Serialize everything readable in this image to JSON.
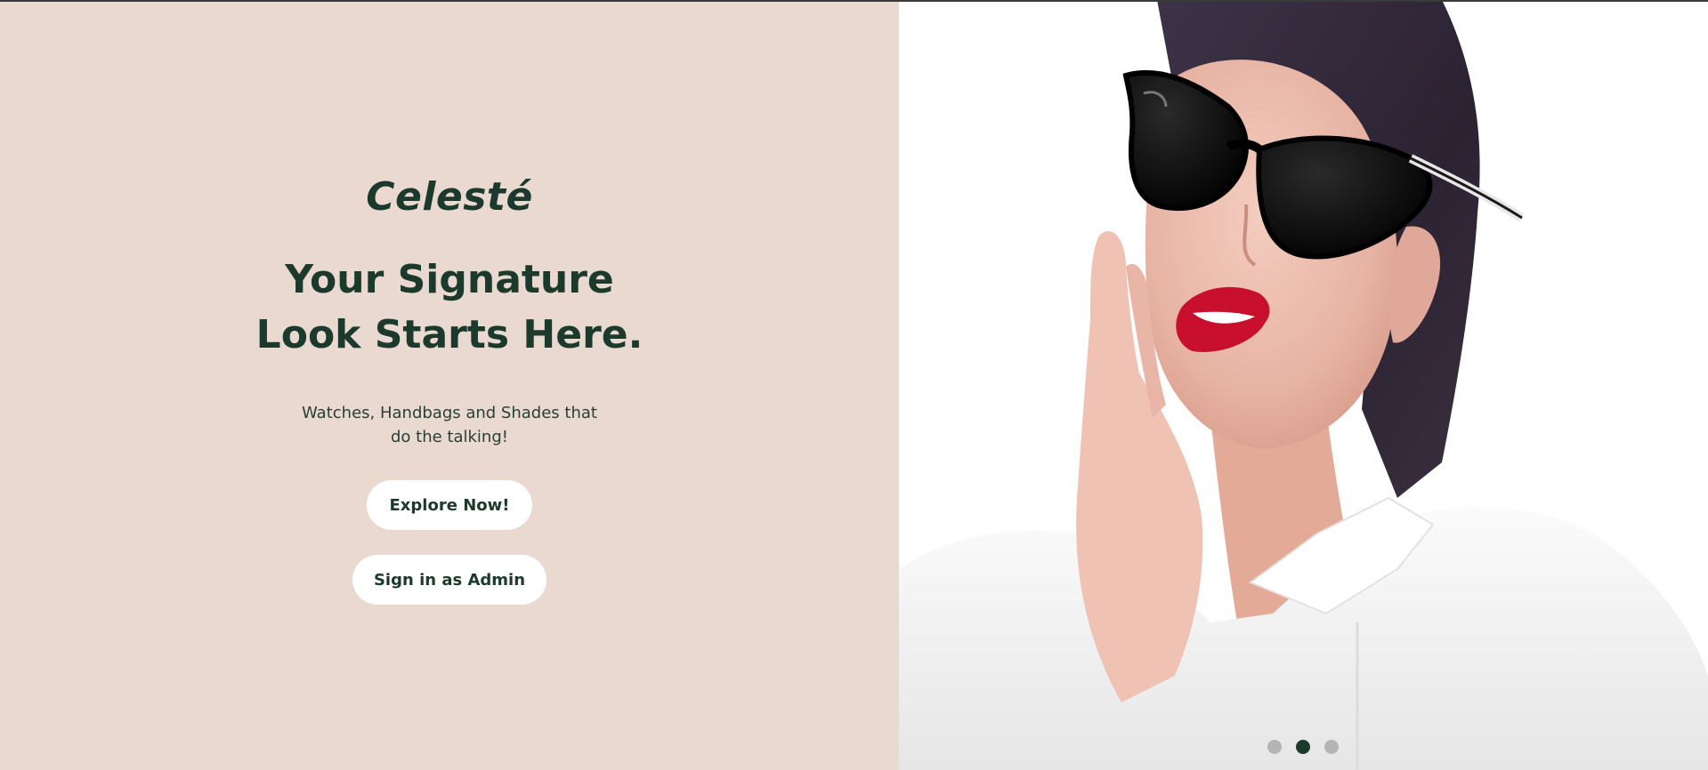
{
  "hero": {
    "brand": "Celesté",
    "headline_line1": "Your Signature",
    "headline_line2": "Look Starts Here.",
    "subtext_line1": "Watches, Handbags and Shades that",
    "subtext_line2": "do the talking!",
    "explore_label": "Explore Now!",
    "admin_label": "Sign in as Admin"
  },
  "carousel": {
    "slide_count": 3,
    "active_index": 1
  },
  "colors": {
    "left_background": "#e9d9d1",
    "brand_green": "#1c3a2b",
    "button_background": "#ffffff",
    "dot_inactive": "#b5b5b5",
    "dot_active": "#1c3a2b"
  }
}
